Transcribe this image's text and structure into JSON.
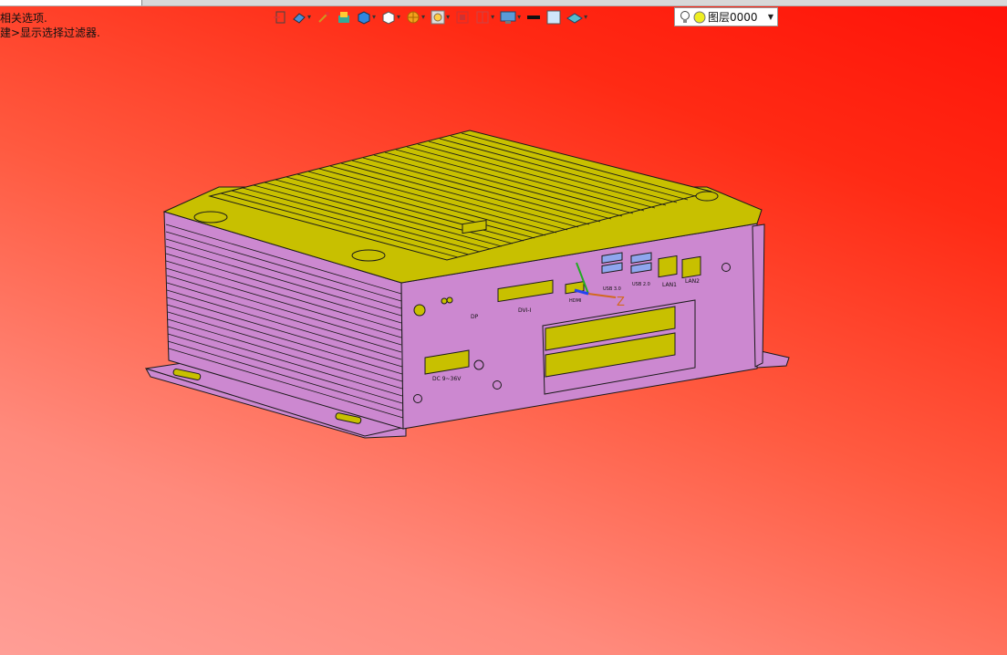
{
  "window": {
    "top_strip": ""
  },
  "hints": {
    "line1": "相关选项.",
    "line2": "建>显示选择过滤器."
  },
  "toolbar": {
    "icons": [
      "exit-sketch-icon",
      "view-orientation-icon",
      "edit-appearance-icon",
      "apply-scene-icon",
      "display-style-icon",
      "hide-show-icon",
      "section-view-icon",
      "zoom-fit-icon",
      "zoom-area-icon",
      "view-split-icon",
      "monitor-settings-icon",
      "line-color-icon",
      "fill-color-icon",
      "layer-display-icon"
    ],
    "layer": {
      "label": "图层0000",
      "bulb_icon": "lightbulb-icon",
      "status_icon": "layer-color-icon"
    }
  },
  "model": {
    "colors": {
      "top": "#c8c000",
      "sides": "#cc88d0",
      "edge": "#1a1a1a"
    },
    "port_labels": {
      "dp": "DP",
      "dvi": "DVI-I",
      "hdmi": "HDMI",
      "usb_a": "USB 3.0",
      "usb_b": "USB 2.0",
      "lan1": "LAN1",
      "lan2": "LAN2",
      "dc": "DC 9~36V",
      "triad_z": "Z"
    }
  }
}
